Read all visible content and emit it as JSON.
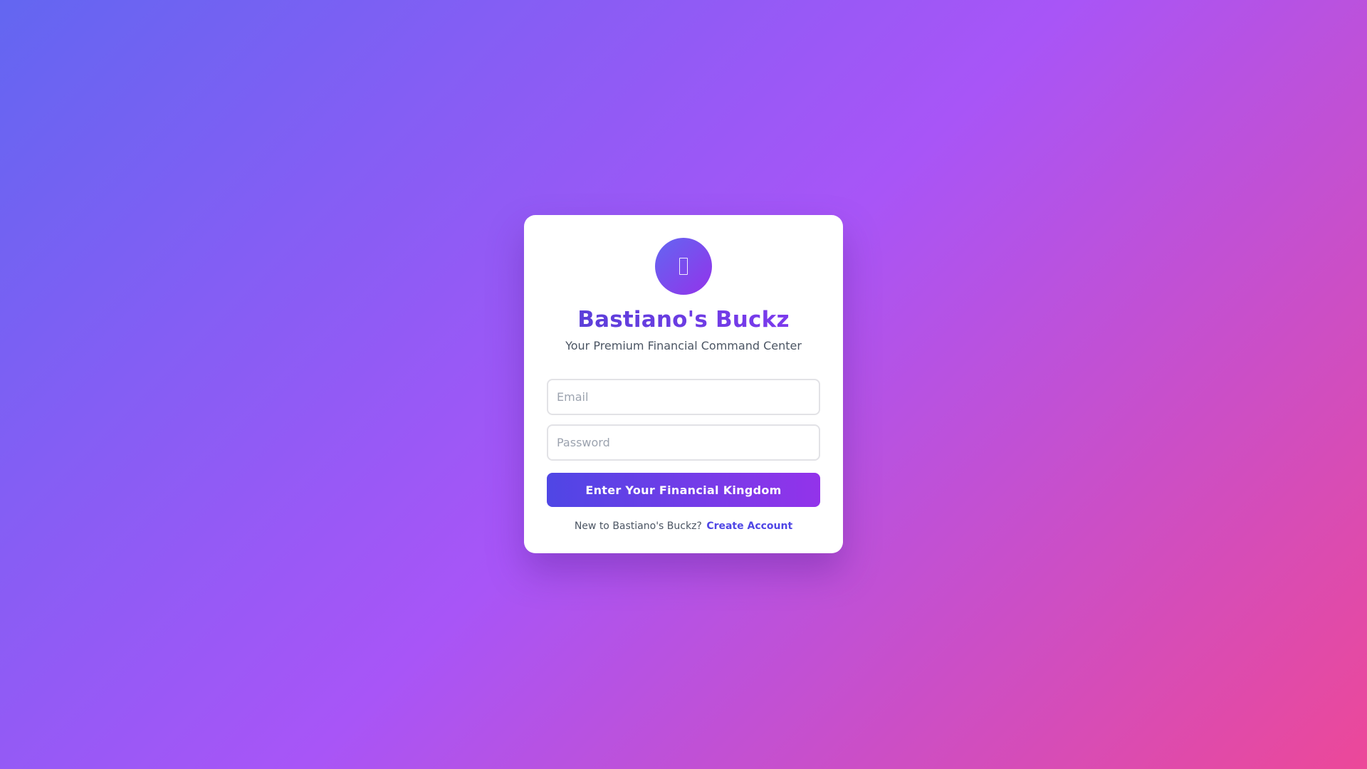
{
  "brand": {
    "logo_icon": "wallet-icon",
    "title": "Bastiano's Buckz",
    "subtitle": "Your Premium Financial Command Center"
  },
  "form": {
    "email_placeholder": "Email",
    "email_value": "",
    "password_placeholder": "Password",
    "password_value": "",
    "submit_label": "Enter Your Financial Kingdom"
  },
  "signup": {
    "prompt": "New to Bastiano's Buckz?",
    "link_label": "Create Account"
  },
  "colors": {
    "background_start": "#6366f1",
    "background_mid": "#a855f7",
    "background_end": "#ec4899",
    "accent": "#4f46e5",
    "accent_secondary": "#9333ea",
    "card": "#ffffff"
  }
}
